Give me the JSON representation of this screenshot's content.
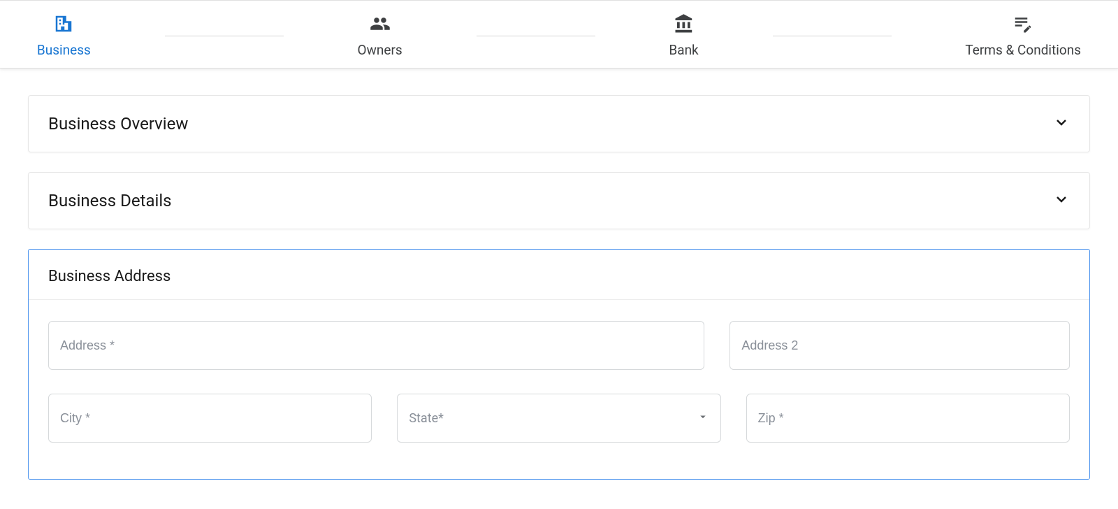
{
  "tabs": {
    "business": {
      "label": "Business"
    },
    "owners": {
      "label": "Owners"
    },
    "bank": {
      "label": "Bank"
    },
    "terms": {
      "label": "Terms & Conditions"
    }
  },
  "sections": {
    "overview": {
      "title": "Business Overview"
    },
    "details": {
      "title": "Business Details"
    },
    "address": {
      "title": "Business Address"
    }
  },
  "form": {
    "address1": {
      "placeholder": "Address *",
      "value": ""
    },
    "address2": {
      "placeholder": "Address 2",
      "value": ""
    },
    "city": {
      "placeholder": "City *",
      "value": ""
    },
    "state": {
      "placeholder": "State*",
      "value": ""
    },
    "zip": {
      "placeholder": "Zip *",
      "value": ""
    }
  }
}
